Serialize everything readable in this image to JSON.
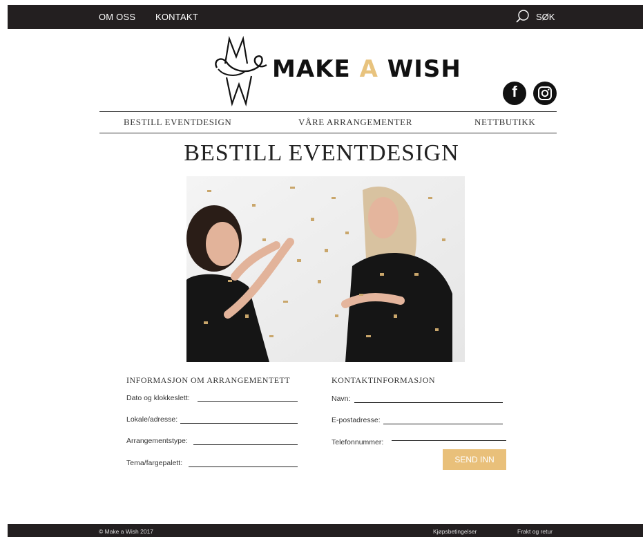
{
  "topbar": {
    "nav_about": "OM OSS",
    "nav_contact": "KONTAKT",
    "search_label": "SØK"
  },
  "logo": {
    "word1": "MAKE",
    "word2": "A",
    "word3": "WISH"
  },
  "social": {
    "facebook": "f"
  },
  "main_nav": [
    {
      "label": "BESTILL EVENTDESIGN"
    },
    {
      "label": "VÅRE ARRANGEMENTER"
    },
    {
      "label": "NETTBUTIKK"
    }
  ],
  "page": {
    "title": "BESTILL EVENTDESIGN"
  },
  "form": {
    "event_section": {
      "heading": "INFORMASJON OM ARRANGEMENTETT",
      "fields": [
        {
          "label": "Dato og klokkeslett:"
        },
        {
          "label": "Lokale/adresse:"
        },
        {
          "label": "Arrangementstype:"
        },
        {
          "label": "Tema/fargepalett:"
        }
      ]
    },
    "contact_section": {
      "heading": "KONTAKTINFORMASJON",
      "fields": [
        {
          "label": "Navn:"
        },
        {
          "label": "E-postadresse:"
        },
        {
          "label": "Telefonnummer:"
        }
      ]
    },
    "submit_label": "SEND INN"
  },
  "footer": {
    "copyright": "© Make a Wish 2017",
    "link_terms": "Kjøpsbetingelser",
    "link_shipping": "Frakt og retur"
  },
  "colors": {
    "dark": "#231f20",
    "accent": "#e8c37e",
    "button": "#e9c07a"
  }
}
